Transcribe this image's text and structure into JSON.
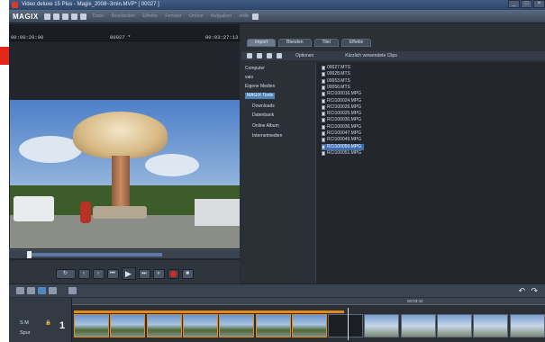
{
  "window": {
    "title": "Video deluxe 15 Plus - Magix_2008~3min.MVP* [ 00027 ]"
  },
  "menubar": {
    "logo": "MAGIX",
    "items": [
      "Datei",
      "Bearbeiten",
      "Effekte",
      "Fenster",
      "Online",
      "Aufgaben",
      "Hilfe"
    ]
  },
  "monitor": {
    "timecode_left": "00:00:20:00",
    "timecode_center": "00027 *",
    "timecode_right": "00:03:27:13"
  },
  "explorer": {
    "tabs": [
      "Import",
      "Blenden",
      "Titel",
      "Effekte"
    ],
    "toolbar_options": "Optionen",
    "toolbar_filter": "Kürzlich verwendete Clips",
    "tree": [
      "Computer",
      "vaio",
      "Eigene Medien",
      "MAGIX Tools",
      "Downloads",
      "Datenbank",
      "Online Album",
      "Internetmedien"
    ],
    "tree_selected_index": 3,
    "files": [
      "00027.MTS",
      "00028.MTS",
      "00053.MTS",
      "00056.MTS",
      "RCI100016.MPG",
      "RCI100024.MPG",
      "RCI100026.MPG",
      "RCI100025.MPG",
      "RCI100030.MPG",
      "RCI100036.MPG",
      "RCI100047.MPG",
      "RCI100049.MPG",
      "RCI100050.MPG",
      "RCI100051.MPG"
    ],
    "files_selected_index": 12
  },
  "timeline": {
    "track_label_top": "S M",
    "track_label_bottom": "Spur",
    "track_number": "1",
    "ruler_mark": "00:03:42",
    "undo_icon": "undo-icon",
    "redo_icon": "redo-icon"
  },
  "transport": {
    "buttons": [
      "loop",
      "prev-marker",
      "next-marker",
      "skip-start",
      "play",
      "skip-end",
      "fast-forward",
      "record",
      "stop"
    ]
  },
  "colors": {
    "accent": "#4f80b8",
    "record": "#e0261c",
    "clip_border": "#e08a22"
  }
}
